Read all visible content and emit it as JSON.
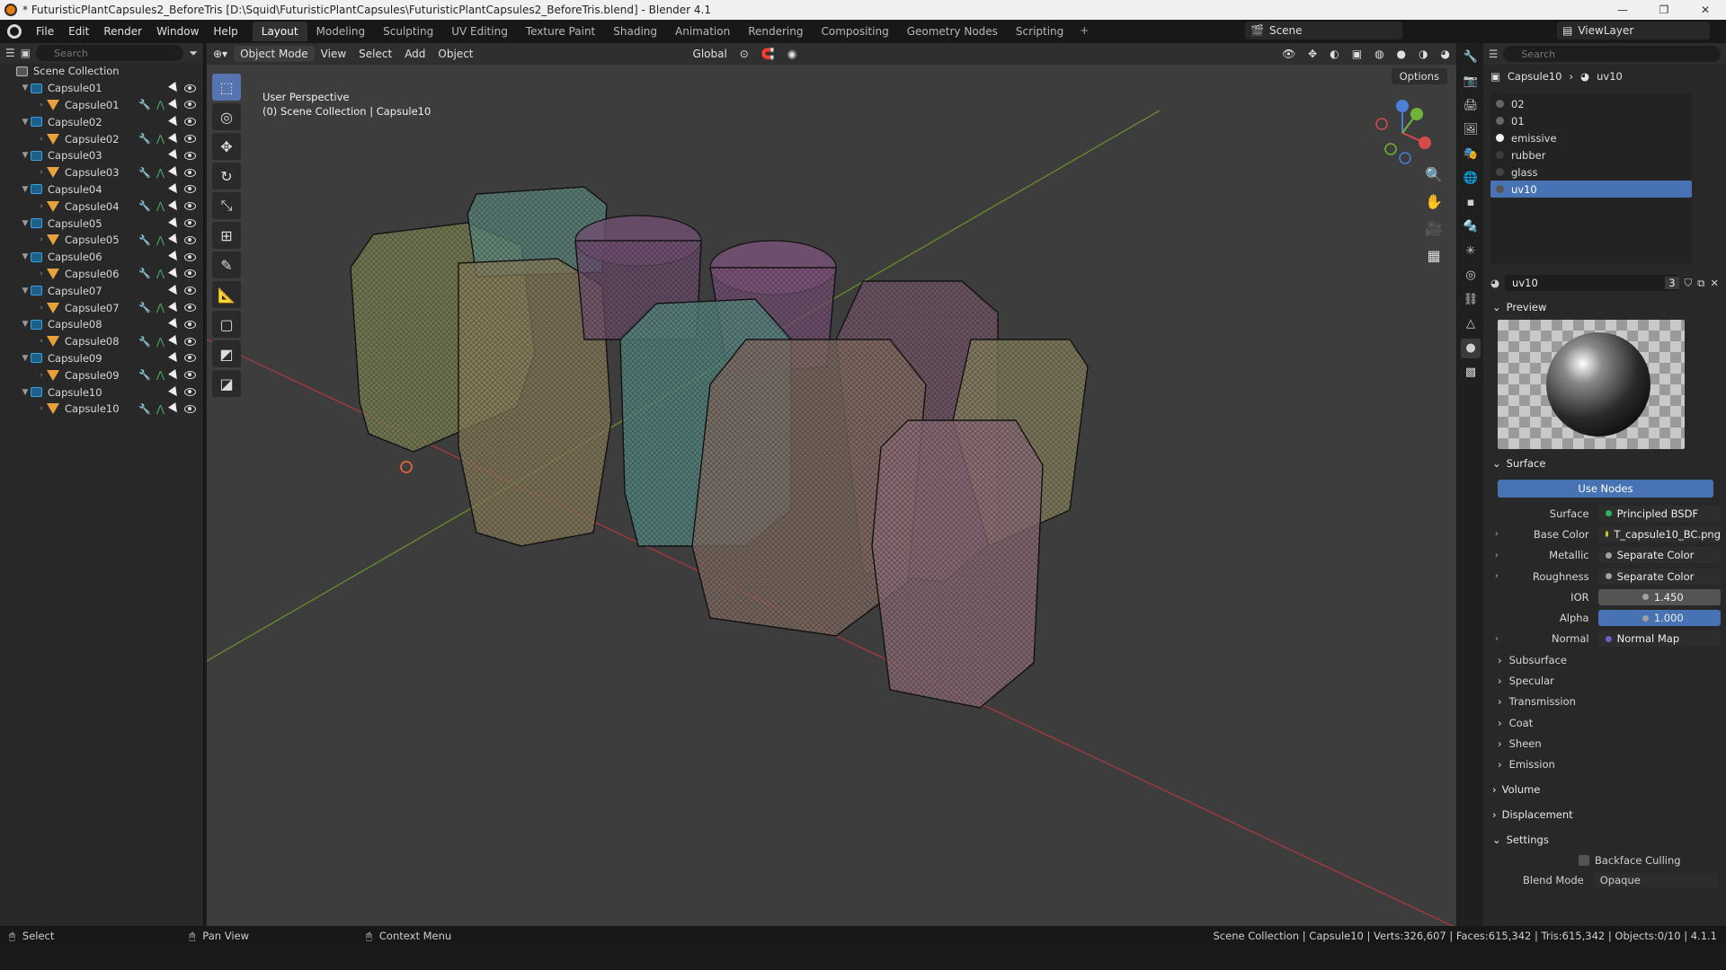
{
  "window": {
    "title": "* FuturisticPlantCapsules2_BeforeTris [D:\\Squid\\FuturisticPlantCapsules\\FuturisticPlantCapsules2_BeforeTris.blend] - Blender 4.1"
  },
  "menu": {
    "items": [
      "File",
      "Edit",
      "Render",
      "Window",
      "Help"
    ]
  },
  "workspaces": [
    "Layout",
    "Modeling",
    "Sculpting",
    "UV Editing",
    "Texture Paint",
    "Shading",
    "Animation",
    "Rendering",
    "Compositing",
    "Geometry Nodes",
    "Scripting"
  ],
  "active_workspace": "Layout",
  "scene": "Scene",
  "view_layer": "ViewLayer",
  "outliner": {
    "search_placeholder": "Search",
    "root": "Scene Collection",
    "collections": [
      {
        "name": "Capsule01",
        "object": "Capsule01"
      },
      {
        "name": "Capsule02",
        "object": "Capsule02"
      },
      {
        "name": "Capsule03",
        "object": "Capsule03"
      },
      {
        "name": "Capsule04",
        "object": "Capsule04"
      },
      {
        "name": "Capsule05",
        "object": "Capsule05"
      },
      {
        "name": "Capsule06",
        "object": "Capsule06"
      },
      {
        "name": "Capsule07",
        "object": "Capsule07"
      },
      {
        "name": "Capsule08",
        "object": "Capsule08"
      },
      {
        "name": "Capsule09",
        "object": "Capsule09"
      },
      {
        "name": "Capsule10",
        "object": "Capsule10"
      }
    ]
  },
  "viewport": {
    "mode": "Object Mode",
    "menus": [
      "View",
      "Select",
      "Add",
      "Object"
    ],
    "transform_orientation": "Global",
    "options": "Options",
    "info_line1": "User Perspective",
    "info_line2": "(0) Scene Collection | Capsule10"
  },
  "properties": {
    "search_placeholder": "Search",
    "breadcrumb_object": "Capsule10",
    "breadcrumb_material": "uv10",
    "slots": [
      "02",
      "01",
      "emissive",
      "rubber",
      "glass",
      "uv10"
    ],
    "active_slot": "uv10",
    "material_name": "uv10",
    "user_count": "3",
    "preview_label": "Preview",
    "surface_label": "Surface",
    "use_nodes": "Use Nodes",
    "rows": [
      {
        "label": "Surface",
        "value": "Principled BSDF",
        "socket": "#2fb35c"
      },
      {
        "label": "Base Color",
        "value": "T_capsule10_BC.png",
        "socket": "#c7c729"
      },
      {
        "label": "Metallic",
        "value": "Separate Color",
        "socket": "#a1a1a1"
      },
      {
        "label": "Roughness",
        "value": "Separate Color",
        "socket": "#a1a1a1"
      },
      {
        "label": "IOR",
        "value": "1.450",
        "socket": "#a1a1a1"
      },
      {
        "label": "Alpha",
        "value": "1.000",
        "socket": "#a1a1a1"
      },
      {
        "label": "Normal",
        "value": "Normal Map",
        "socket": "#6363c7"
      }
    ],
    "subpanels": [
      "Subsurface",
      "Specular",
      "Transmission",
      "Coat",
      "Sheen",
      "Emission"
    ],
    "volume": "Volume",
    "displacement": "Displacement",
    "settings": "Settings",
    "backface_culling": "Backface Culling",
    "blend_mode_label": "Blend Mode",
    "blend_mode_value": "Opaque"
  },
  "status": {
    "select": "Select",
    "pan": "Pan View",
    "context": "Context Menu",
    "info": "Scene Collection | Capsule10 | Verts:326,607 | Faces:615,342 | Tris:615,342 | Objects:0/10 | 4.1.1"
  },
  "colors": {
    "accent": "#4772b3",
    "active_tool": "#5574b0"
  }
}
